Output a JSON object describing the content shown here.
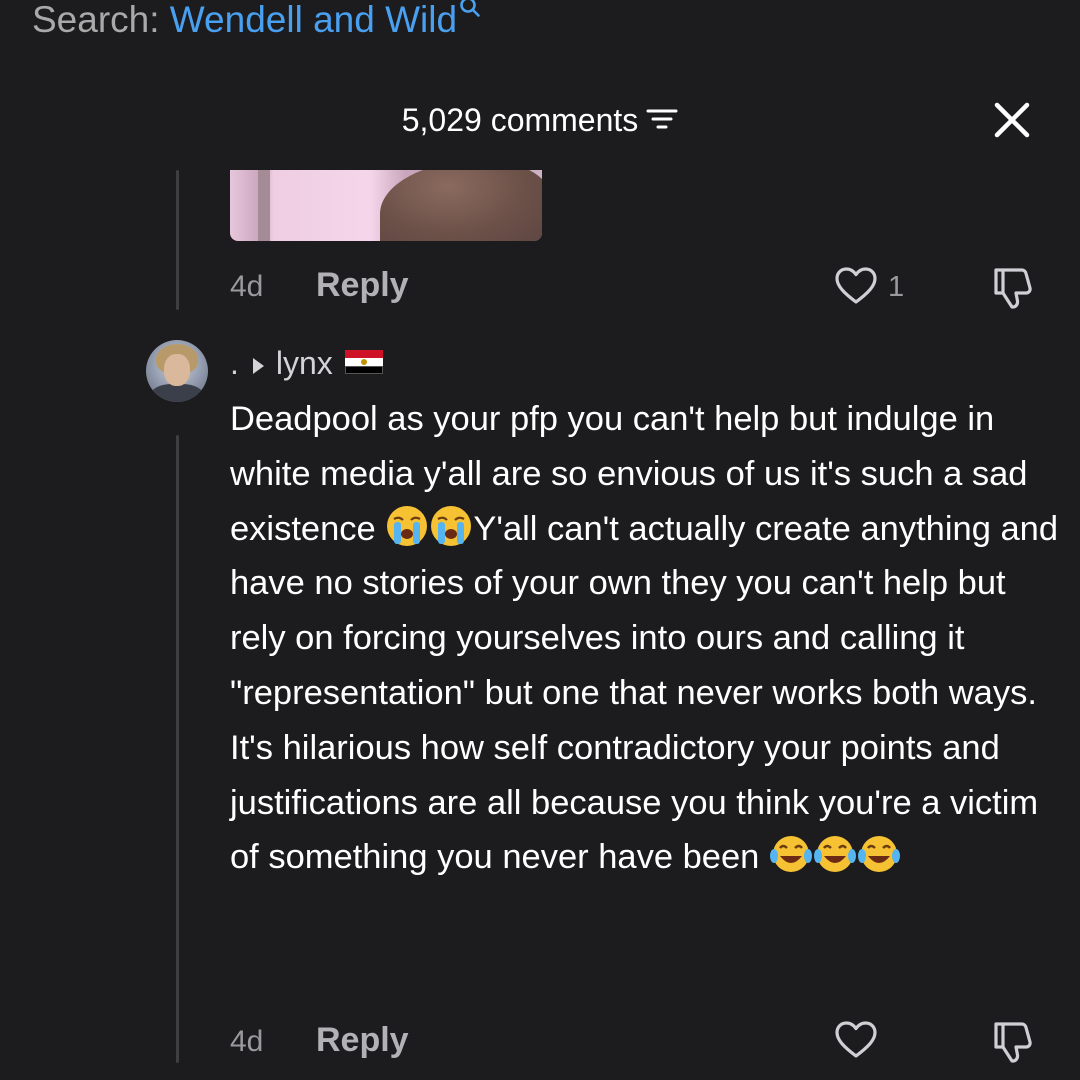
{
  "search": {
    "prefix": "Search:",
    "query": "Wendell and Wild"
  },
  "header": {
    "comments_count": "5,029 comments"
  },
  "previous_reply": {
    "time": "4d",
    "reply_label": "Reply",
    "likes": "1"
  },
  "comment": {
    "user_prefix": ".",
    "username": "lynx",
    "flag": "Egypt flag",
    "text_part1": "Deadpool as your pfp you can't help but indulge in white media y'all are so envious of us it's such a sad existence ",
    "text_part2": "Y'all can't actually create anything and have no stories of your own they you can't help but rely on forcing yourselves into ours and calling it \"representation\" but one that never works both ways. It's hilarious how self contradictory your points and justifications are all because you think you're a victim of something you never have been ",
    "emojis_crying": [
      "loudly-crying-face",
      "loudly-crying-face"
    ],
    "emojis_laughing": [
      "face-with-tears-of-joy",
      "face-with-tears-of-joy",
      "face-with-tears-of-joy"
    ],
    "time": "4d",
    "reply_label": "Reply"
  },
  "colors": {
    "background": "#1c1c1e",
    "search_query": "#4aa0f0",
    "meta_gray": "#9a9a9e"
  }
}
